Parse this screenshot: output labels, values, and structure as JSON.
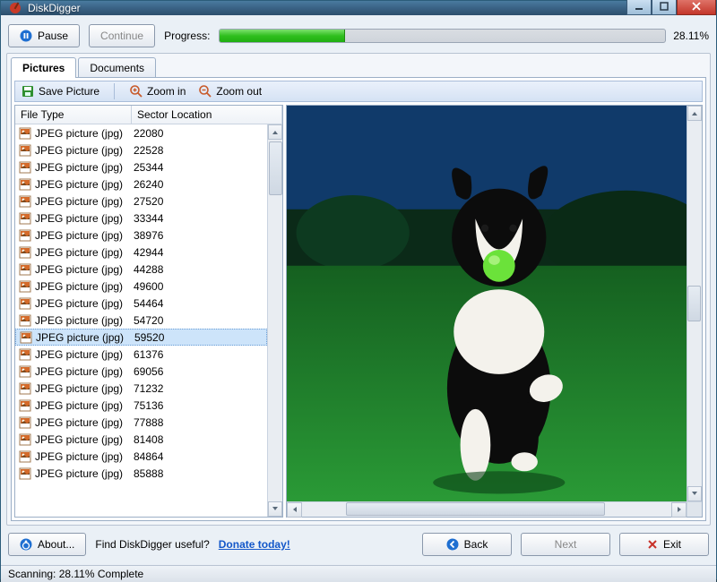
{
  "window": {
    "title": "DiskDigger"
  },
  "topbar": {
    "pause_label": "Pause",
    "continue_label": "Continue",
    "progress_label": "Progress:",
    "progress_pct_text": "28.11%",
    "progress_pct_value": 28.11
  },
  "tabs": {
    "pictures": "Pictures",
    "documents": "Documents",
    "active": "pictures"
  },
  "toolbar": {
    "save_label": "Save Picture",
    "zoom_in_label": "Zoom in",
    "zoom_out_label": "Zoom out"
  },
  "list": {
    "col_file_type": "File Type",
    "col_sector": "Sector Location",
    "selected_index": 12,
    "rows": [
      {
        "ft": "JPEG picture (jpg)",
        "sl": "22080"
      },
      {
        "ft": "JPEG picture (jpg)",
        "sl": "22528"
      },
      {
        "ft": "JPEG picture (jpg)",
        "sl": "25344"
      },
      {
        "ft": "JPEG picture (jpg)",
        "sl": "26240"
      },
      {
        "ft": "JPEG picture (jpg)",
        "sl": "27520"
      },
      {
        "ft": "JPEG picture (jpg)",
        "sl": "33344"
      },
      {
        "ft": "JPEG picture (jpg)",
        "sl": "38976"
      },
      {
        "ft": "JPEG picture (jpg)",
        "sl": "42944"
      },
      {
        "ft": "JPEG picture (jpg)",
        "sl": "44288"
      },
      {
        "ft": "JPEG picture (jpg)",
        "sl": "49600"
      },
      {
        "ft": "JPEG picture (jpg)",
        "sl": "54464"
      },
      {
        "ft": "JPEG picture (jpg)",
        "sl": "54720"
      },
      {
        "ft": "JPEG picture (jpg)",
        "sl": "59520"
      },
      {
        "ft": "JPEG picture (jpg)",
        "sl": "61376"
      },
      {
        "ft": "JPEG picture (jpg)",
        "sl": "69056"
      },
      {
        "ft": "JPEG picture (jpg)",
        "sl": "71232"
      },
      {
        "ft": "JPEG picture (jpg)",
        "sl": "75136"
      },
      {
        "ft": "JPEG picture (jpg)",
        "sl": "77888"
      },
      {
        "ft": "JPEG picture (jpg)",
        "sl": "81408"
      },
      {
        "ft": "JPEG picture (jpg)",
        "sl": "84864"
      },
      {
        "ft": "JPEG picture (jpg)",
        "sl": "85888"
      }
    ]
  },
  "preview": {
    "description": "A black-and-white dog running on green grass toward the camera holding a bright green ball in its mouth; dark trees and blue sky in background."
  },
  "footer": {
    "about_label": "About...",
    "useful_text": "Find DiskDigger useful?",
    "donate_label": "Donate today!",
    "back_label": "Back",
    "next_label": "Next",
    "exit_label": "Exit"
  },
  "status": {
    "text": "Scanning: 28.11% Complete"
  }
}
